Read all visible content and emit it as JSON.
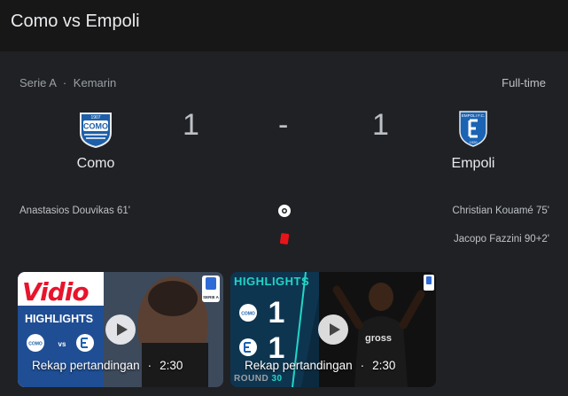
{
  "header": {
    "title": "Como vs Empoli"
  },
  "match": {
    "competition": "Serie A",
    "separator": "·",
    "date": "Kemarin",
    "status": "Full-time",
    "home": {
      "name": "Como",
      "score": "1",
      "crest_label": "COMO",
      "crest_year": "1907"
    },
    "away": {
      "name": "Empoli",
      "score": "1",
      "crest_label": "EMPOLI F.C.",
      "crest_year": "1920"
    },
    "score_separator": "-"
  },
  "events": {
    "home": [
      {
        "text": "Anastasios Douvikas 61'"
      }
    ],
    "away": [
      {
        "text": "Christian Kouamé 75'"
      },
      {
        "text": "Jacopo Fazzini 90+2'"
      }
    ],
    "icons": [
      "soccer-ball-icon",
      "red-card-icon"
    ],
    "red_card_color": "#e8141a"
  },
  "videos": [
    {
      "title": "Rekap pertandingan",
      "separator": "·",
      "duration": "2:30",
      "brand": "Vidio",
      "badge": "HIGHLIGHTS",
      "vs": "vs",
      "league_badge": "SERIE A"
    },
    {
      "title": "Rekap pertandingan",
      "separator": "·",
      "duration": "2:30",
      "badge": "HIGHLIGHTS",
      "home_score": "1",
      "away_score": "1",
      "round": "ROUND",
      "round_no": "30",
      "sponsor": "gross"
    }
  ]
}
